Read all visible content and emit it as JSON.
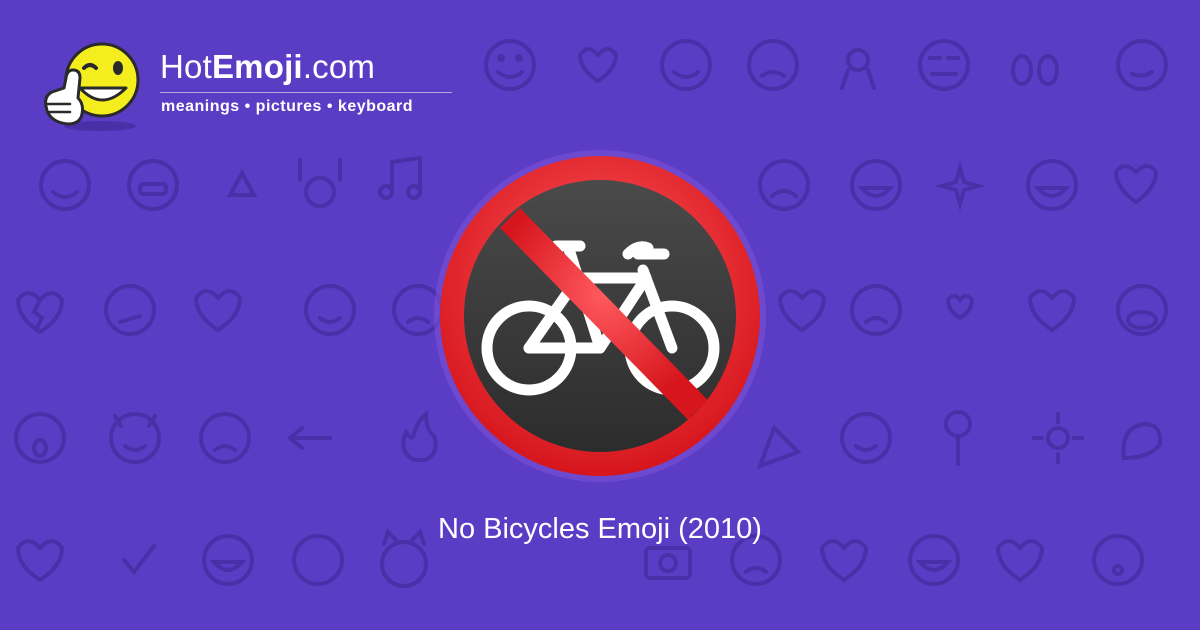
{
  "brand": {
    "name_prefix": "Hot",
    "name_bold": "Emoji",
    "name_suffix": ".com",
    "tagline": "meanings • pictures • keyboard",
    "mascot_icon": "thumbs-up-wink-smiley-icon"
  },
  "hero": {
    "emoji_icon": "no-bicycles-icon",
    "caption": "No Bicycles Emoji (2010)"
  },
  "background": {
    "color": "#5b3cc4",
    "pattern_color": "#4a30a8",
    "pattern_icons": [
      "smiley",
      "kissing-heart",
      "two-hearts",
      "smiley",
      "weary",
      "ok-hand",
      "expressionless",
      "eyes",
      "smirk",
      "relieved",
      "grimacing",
      "recycle",
      "raised-hands",
      "notes",
      "sleeping",
      "frowning",
      "grinning",
      "sparkles",
      "grinning",
      "striped-heart",
      "broken-heart",
      "confused",
      "striped-heart",
      "winking-tongue",
      "persevere",
      "heart-arrow",
      "weary",
      "heart-eyes",
      "heart",
      "see-no-evil-monkey",
      "screaming",
      "smiling-imp",
      "angry",
      "left-arrow",
      "fire",
      "party-popper",
      "stuck-out-tongue",
      "rose",
      "sun",
      "flexed-biceps",
      "striped-heart",
      "check-mark",
      "laughing",
      "new-moon-face",
      "heart-eyes-cat",
      "waving-hand",
      "grinning",
      "camera",
      "persevere",
      "striped-heart",
      "grinning",
      "heart",
      "kissing"
    ]
  },
  "colors": {
    "ring": "#e3242b",
    "disc": "#3a3a3a",
    "bike": "#ffffff",
    "mascot_face": "#f5ee1f"
  }
}
